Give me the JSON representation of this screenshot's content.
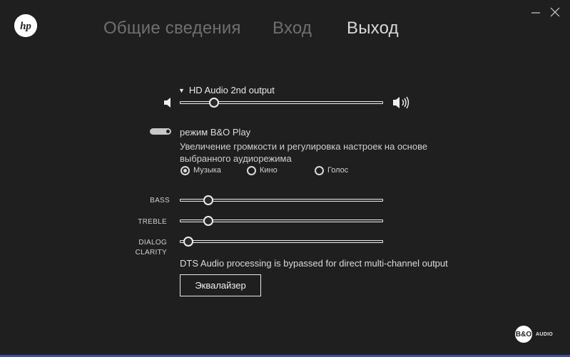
{
  "app": {
    "logo_text": "hp"
  },
  "window_controls": {
    "minimize_icon": "minimize-icon",
    "close_icon": "close-icon"
  },
  "nav": {
    "tabs": [
      {
        "label": "Общие сведения",
        "active": false
      },
      {
        "label": "Вход",
        "active": false
      },
      {
        "label": "Выход",
        "active": true
      }
    ]
  },
  "output": {
    "device_label": "HD Audio 2nd output",
    "volume_level": 0.15
  },
  "bo": {
    "toggle_on": true,
    "title": "режим B&O Play",
    "description": "Увеличение громкости и регулировка настроек на основе выбранного аудиорежима",
    "modes": [
      {
        "label": "Музыка",
        "selected": true
      },
      {
        "label": "Кино",
        "selected": false
      },
      {
        "label": "Голос",
        "selected": false
      }
    ]
  },
  "sliders": {
    "bass": {
      "label": "BASS",
      "level": 0.12
    },
    "treble": {
      "label": "TREBLE",
      "level": 0.12
    },
    "dialog_clarity": {
      "label_line1": "DIALOG",
      "label_line2": "CLARITY",
      "level": 0.02
    }
  },
  "dts_status": "DTS Audio processing is bypassed for direct multi-channel output",
  "equalizer_button": "Эквалайзер",
  "footer": {
    "brand_logo_text": "B&O",
    "brand_label": "AUDIO"
  },
  "colors": {
    "background": "#1f1f1f",
    "accent_bottom": "#3b4ea0",
    "text_active": "#d9d9d9",
    "text_inactive": "#6f6f6f"
  }
}
